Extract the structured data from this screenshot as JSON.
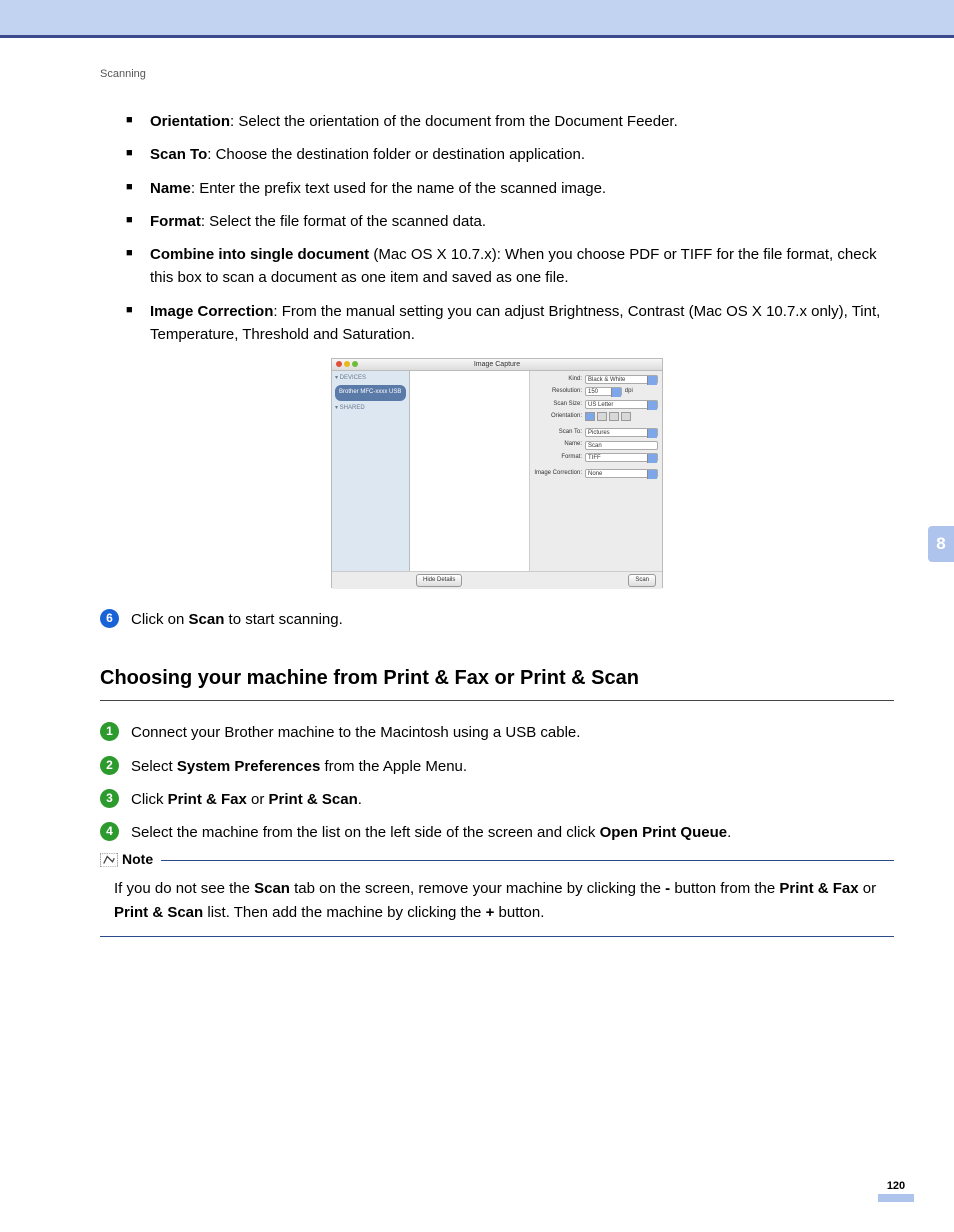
{
  "header": "Scanning",
  "bullets": [
    {
      "term": "Orientation",
      "desc": ": Select the orientation of the document from the Document Feeder."
    },
    {
      "term": "Scan To",
      "desc": ": Choose the destination folder or destination application."
    },
    {
      "term": "Name",
      "desc": ": Enter the prefix text used for the name of the scanned image."
    },
    {
      "term": "Format",
      "desc": ": Select the file format of the scanned data."
    },
    {
      "term": "Combine into single document",
      "desc": " (Mac OS X 10.7.x): When you choose PDF or TIFF for the file format, check this box to scan a document as one item and saved as one file."
    },
    {
      "term": "Image Correction",
      "desc": ": From the manual setting you can adjust Brightness, Contrast (Mac OS X 10.7.x only), Tint, Temperature, Threshold and Saturation."
    }
  ],
  "screenshot": {
    "title": "Image Capture",
    "sidebar": {
      "devices_label": "▾ DEVICES",
      "device": "Brother MFC-xxxx USB",
      "shared_label": "▾ SHARED"
    },
    "fields": {
      "kind_label": "Kind:",
      "kind_value": "Black & White",
      "resolution_label": "Resolution:",
      "resolution_value": "150",
      "resolution_unit": "dpi",
      "scansize_label": "Scan Size:",
      "scansize_value": "US Letter",
      "orientation_label": "Orientation:",
      "scanto_label": "Scan To:",
      "scanto_value": "Pictures",
      "name_label": "Name:",
      "name_value": "Scan",
      "format_label": "Format:",
      "format_value": "TIFF",
      "correction_label": "Image Correction:",
      "correction_value": "None"
    },
    "hide_details": "Hide Details",
    "scan_btn": "Scan"
  },
  "step6_prefix": "Click on ",
  "step6_bold": "Scan",
  "step6_suffix": " to start scanning.",
  "heading2": "Choosing your machine from Print & Fax or Print & Scan",
  "steps2": {
    "s1": "Connect your Brother machine to the Macintosh using a USB cable.",
    "s2_pre": "Select ",
    "s2_bold": "System Preferences",
    "s2_post": " from the Apple Menu.",
    "s3_pre": "Click ",
    "s3_b1": "Print & Fax",
    "s3_mid": " or ",
    "s3_b2": "Print & Scan",
    "s3_post": ".",
    "s4_pre": "Select the machine from the list on the left side of the screen and click ",
    "s4_bold": "Open Print Queue",
    "s4_post": "."
  },
  "note": {
    "title": "Note",
    "pre": "If you do not see the ",
    "b1": "Scan",
    "mid1": " tab on the screen, remove your machine by clicking the ",
    "b2": "-",
    "mid2": " button from the ",
    "b3": "Print & Fax",
    "mid3": " or ",
    "b4": "Print & Scan",
    "mid4": " list. Then add the machine by clicking the ",
    "b5": "+",
    "post": " button."
  },
  "side_tab": "8",
  "page_num": "120"
}
